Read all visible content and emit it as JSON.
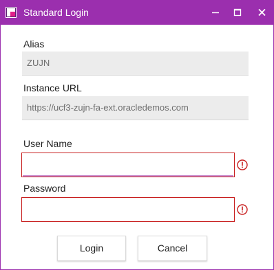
{
  "window": {
    "title": "Standard Login",
    "accent_color": "#9b2fae",
    "icons": {
      "app": "app-icon",
      "minimize": "minimize-icon",
      "maximize": "maximize-icon",
      "close": "close-icon"
    }
  },
  "form": {
    "alias": {
      "label": "Alias",
      "value": "ZUJN"
    },
    "instance_url": {
      "label": "Instance URL",
      "value": "https://ucf3-zujn-fa-ext.oracledemos.com"
    },
    "username": {
      "label": "User Name",
      "value": "",
      "error_icon": "error-icon"
    },
    "password": {
      "label": "Password",
      "value": "",
      "error_icon": "error-icon"
    },
    "error_color": "#c81e1e"
  },
  "buttons": {
    "login_label": "Login",
    "cancel_label": "Cancel"
  }
}
